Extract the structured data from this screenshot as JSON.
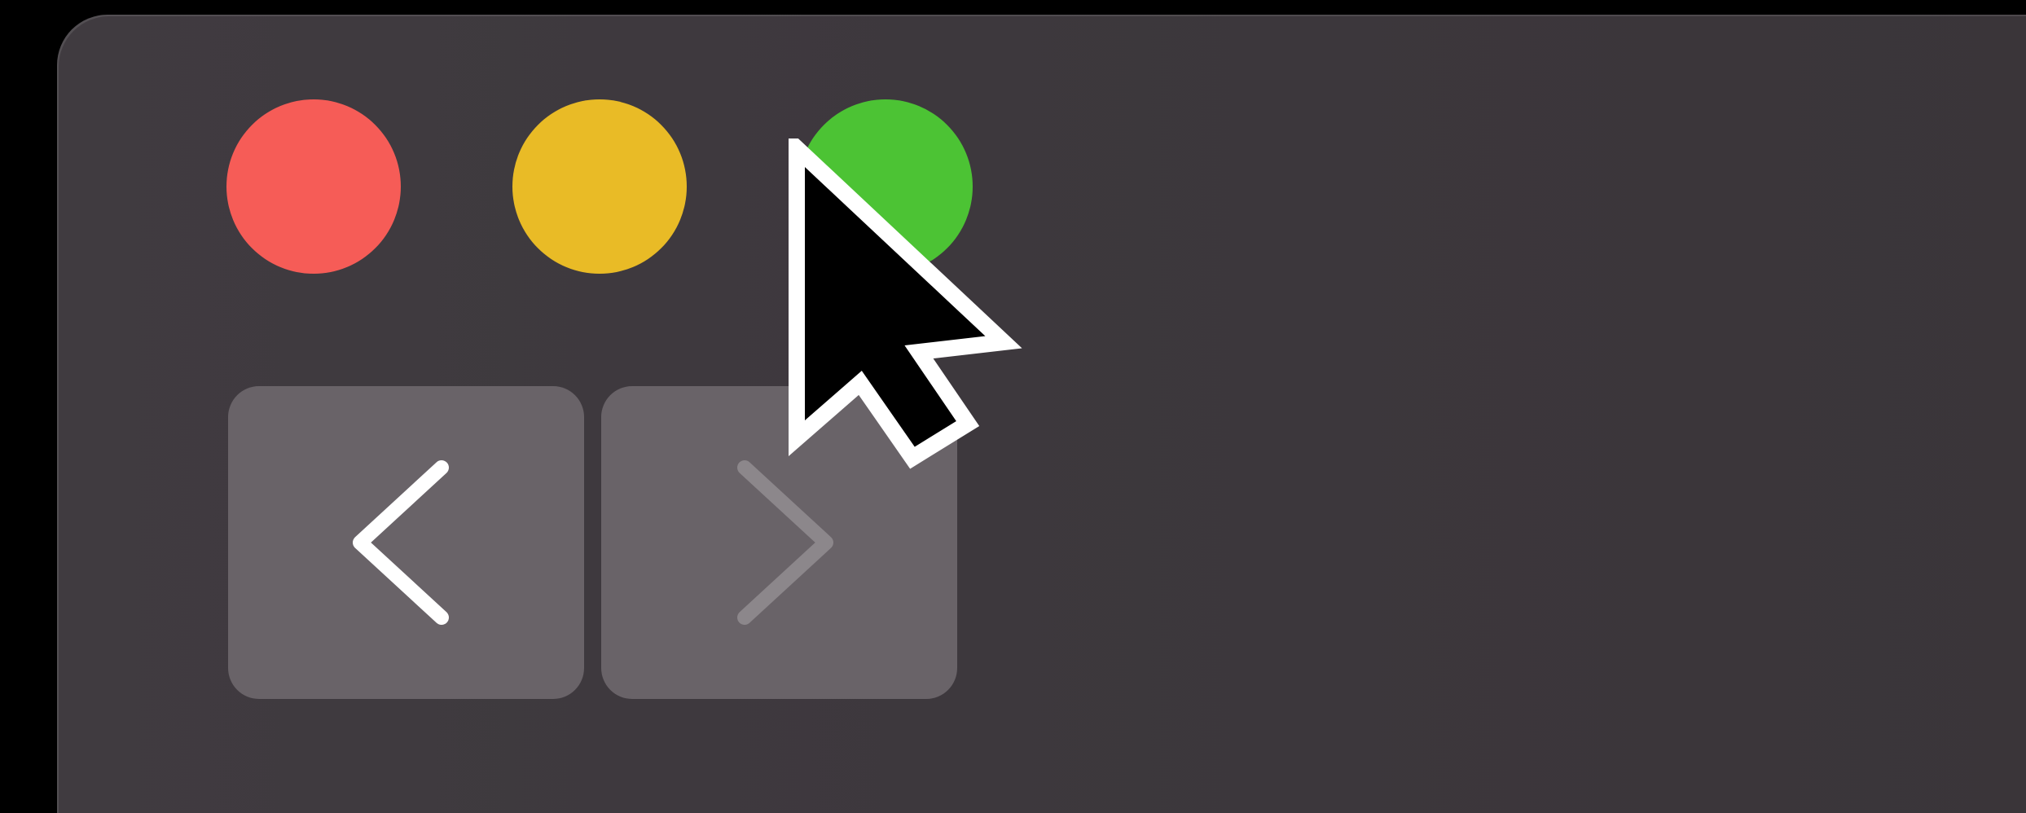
{
  "window": {
    "controls": [
      {
        "name": "close",
        "color": "#f65c57"
      },
      {
        "name": "minimize",
        "color": "#e9bb26"
      },
      {
        "name": "zoom",
        "color": "#4cc334"
      }
    ],
    "navigation": {
      "back": {
        "icon": "chevron-left-icon",
        "enabled": true
      },
      "forward": {
        "icon": "chevron-right-icon",
        "enabled": false
      }
    }
  },
  "cursor": {
    "icon": "arrow-pointer-icon"
  },
  "colors": {
    "window_bg": "#3d383d",
    "button_bg": "#696368",
    "chevron_enabled": "#ffffff",
    "chevron_disabled": "#8c878b"
  }
}
